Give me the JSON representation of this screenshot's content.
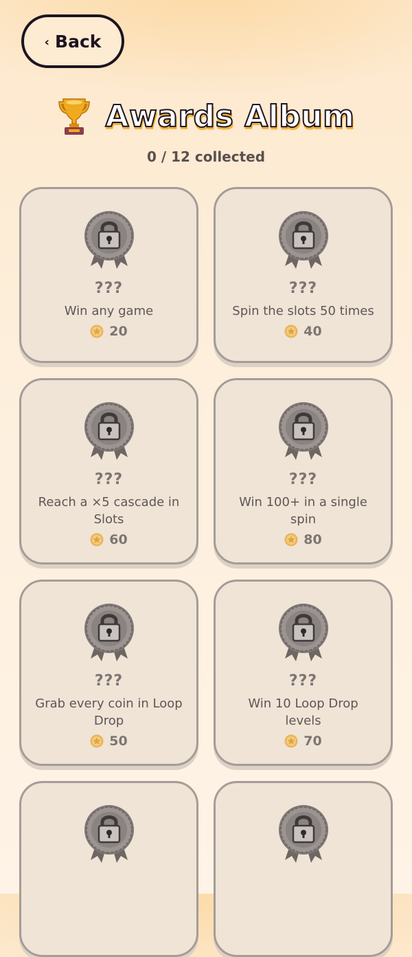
{
  "header": {
    "back_label": "Back",
    "back_icon": "chevron-left-icon",
    "title": "Awards Album",
    "title_icon": "trophy-icon",
    "collected_text": "0 / 12 collected"
  },
  "awards": [
    {
      "name": "???",
      "description": "Win any game",
      "reward": "20",
      "locked": true
    },
    {
      "name": "???",
      "description": "Spin the slots 50 times",
      "reward": "40",
      "locked": true
    },
    {
      "name": "???",
      "description": "Reach a ×5 cascade in Slots",
      "reward": "60",
      "locked": true
    },
    {
      "name": "???",
      "description": "Win 100+ in a single spin",
      "reward": "80",
      "locked": true
    },
    {
      "name": "???",
      "description": "Grab every coin in Loop Drop",
      "reward": "50",
      "locked": true
    },
    {
      "name": "???",
      "description": "Win 10 Loop Drop levels",
      "reward": "70",
      "locked": true
    },
    {
      "name": "",
      "description": "",
      "reward": "",
      "locked": true
    },
    {
      "name": "",
      "description": "",
      "reward": "",
      "locked": true
    }
  ],
  "colors": {
    "accent_outline": "#1d1420",
    "title_shadow": "#f2b13a",
    "card_bg": "#efe4d6",
    "card_border": "#a59c97"
  }
}
